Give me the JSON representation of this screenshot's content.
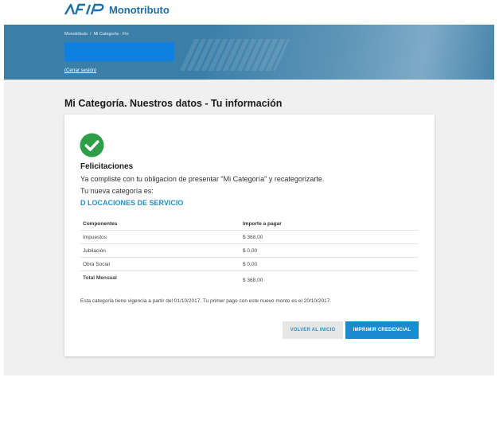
{
  "header": {
    "brand": "Monotributo",
    "logo_name": "AFIP"
  },
  "banner": {
    "breadcrumb": [
      "Monotributo",
      "Mi Categoría - Fin"
    ],
    "breadcrumb_sep": "/",
    "logout_label": "(Cerrar sesión)"
  },
  "page": {
    "title": "Mi Categoría. Nuestros datos - Tu información"
  },
  "card": {
    "heading": "Felicitaciones",
    "message": "Ya compliste con tu obligacion de presentar \"Mi Categoría\" y recategorizarte.",
    "new_category_label": "Tu nueva categoría es:",
    "category_value": "D LOCACIONES DE SERVICIO",
    "table": {
      "headers": [
        "Componentes",
        "Importe a pagar"
      ],
      "rows": [
        [
          "Impuestos",
          "$ 368,00"
        ],
        [
          "Jubilación",
          "$ 0,00"
        ],
        [
          "Obra Social",
          "$ 0,00"
        ]
      ],
      "total": [
        "Total Mensual",
        "$ 368,00"
      ]
    },
    "note": "Esta categoría tiene vigencia a partir del 01/10/2017. Tu primer pago con este nuevo monto es el 20/10/2017.",
    "buttons": {
      "back": "VOLVER AL INICIO",
      "print": "IMPRIMIR CREDENCIAL"
    }
  },
  "colors": {
    "banner": "#3b7fa8",
    "accent": "#2a8fc1",
    "primary_button": "#1b8bd1",
    "success": "#2e9e48"
  },
  "icons": {
    "logo": "afip-logo-icon",
    "success": "check-circle-icon"
  }
}
